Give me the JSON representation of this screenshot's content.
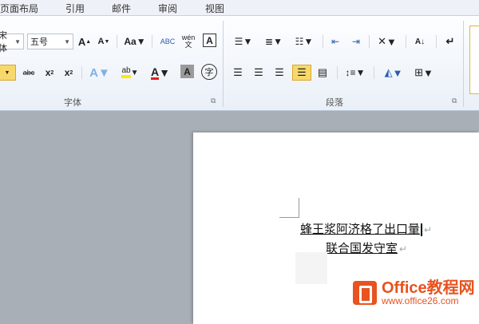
{
  "tabs": [
    "页面布局",
    "引用",
    "邮件",
    "审阅",
    "视图"
  ],
  "font": {
    "name": "宋体",
    "size": "五号",
    "group_label": "字体"
  },
  "paragraph": {
    "group_label": "段落"
  },
  "glyphs": {
    "grow": "A",
    "shrink": "A",
    "case": "Aa",
    "pinyin": "wén",
    "charborder": "A",
    "strike": "abc",
    "sub": "x",
    "sup": "x",
    "effects": "A",
    "highlight": "ab",
    "fontcolor": "A",
    "shade": "A",
    "enclose": "字",
    "sort": "A↓",
    "pilcrow": "↵"
  },
  "document": {
    "line1": "蜂王浆阿济格了出口量",
    "line2": "联合国发守室",
    "paragraph_mark": "↵"
  },
  "watermark": {
    "brand": "Office教程网",
    "url": "www.office26.com"
  }
}
